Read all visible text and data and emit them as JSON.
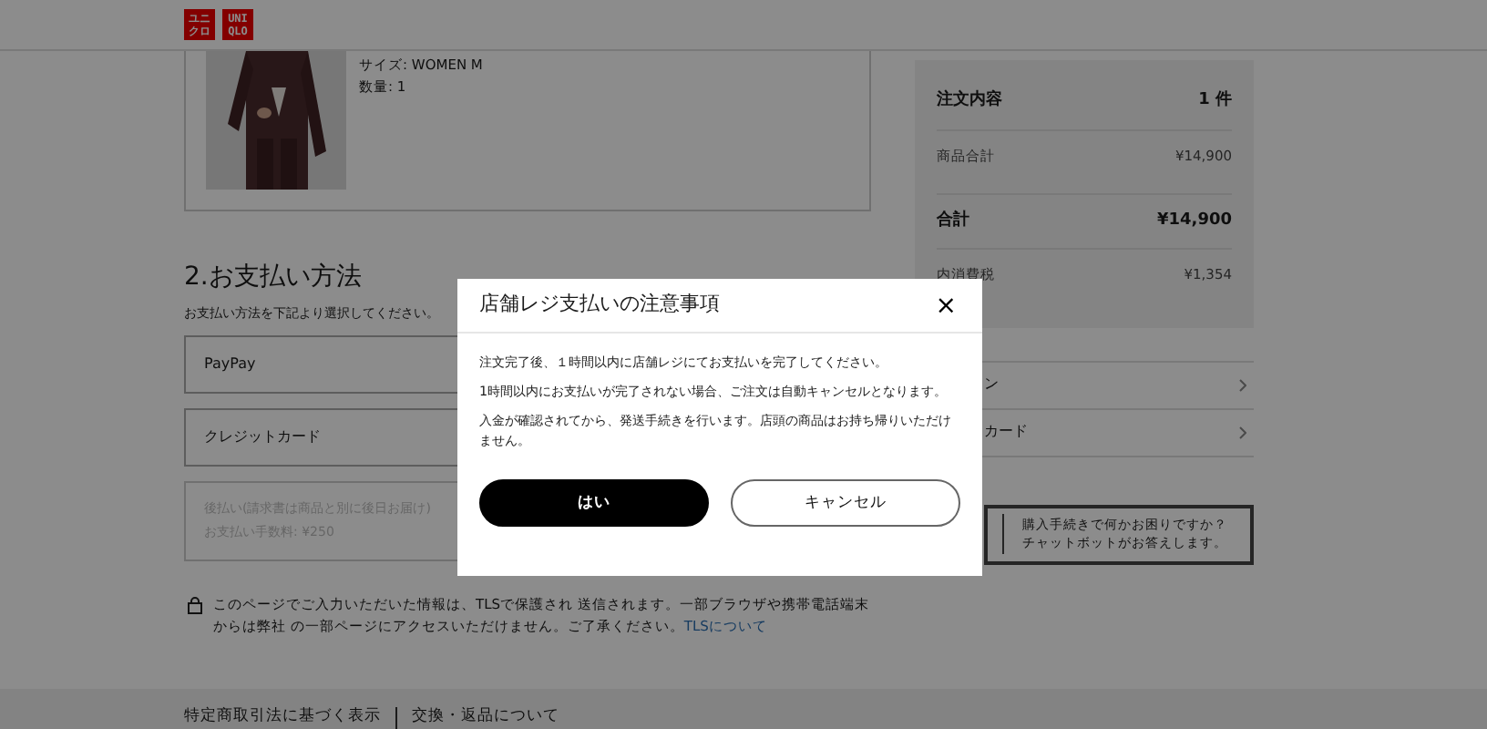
{
  "header": {
    "logo": [
      {
        "text": "ユニクロ"
      },
      {
        "text": "UNIQLO"
      }
    ]
  },
  "product": {
    "details": [
      "サイズ: WOMEN M",
      "数量: 1"
    ]
  },
  "payment": {
    "heading": "2.お支払い方法",
    "description": "お支払い方法を下記より選択してください。",
    "options": [
      {
        "label": "PayPay",
        "disabled": false
      },
      {
        "label": "クレジットカード",
        "disabled": false
      },
      {
        "label": "後払い(請求書は商品と別に後日お届け)",
        "note": "お支払い手数料: ¥250",
        "disabled": true
      }
    ]
  },
  "security_note": {
    "text": "このページでご入力いただいた情報は、TLSで保護され 送信されます。一部ブラウザや携帯電話端末からは弊社 の一部ページにアクセスいただけません。ご了承ください。",
    "link": "TLSについて"
  },
  "summary": {
    "rows": [
      {
        "label": "注文内容",
        "value": "1 件",
        "kind": "header"
      },
      {
        "label": "商品合計",
        "value": "¥14,900",
        "kind": "line"
      },
      {
        "label": "合計",
        "value": "¥14,900",
        "kind": "total"
      },
      {
        "label": "内消費税",
        "value": "¥1,354",
        "kind": "line"
      }
    ]
  },
  "links": [
    {
      "label": "ン"
    },
    {
      "label": "カード"
    }
  ],
  "chatbot": {
    "lines": [
      "購入手続きで何かお困りですか？",
      "チャットボットがお答えします。"
    ]
  },
  "footer": {
    "links": [
      "特定商取引法に基づく表示",
      "交換・返品について"
    ]
  },
  "dialog": {
    "title": "店舗レジ支払いの注意事項",
    "close": "×",
    "paragraphs": [
      "注文完了後、１時間以内に店舗レジにてお支払いを完了してください。",
      "1時間以内にお支払いが完了されない場合、ご注文は自動キャンセルとなります。",
      "入金が確認されてから、発送手続きを行います。店頭の商品はお持ち帰りいただけません。"
    ],
    "buttons": [
      {
        "label": "はい",
        "kind": "primary"
      },
      {
        "label": "キャンセル",
        "kind": "secondary"
      }
    ]
  }
}
